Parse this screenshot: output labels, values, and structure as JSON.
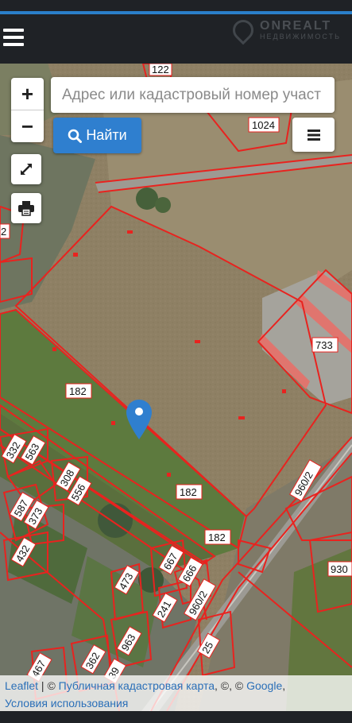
{
  "header": {
    "menu_icon": "hamburger-icon",
    "logo_brand": "ONREALT",
    "logo_sub": "НЕДВИЖИМОСТЬ"
  },
  "controls": {
    "zoom_in": "+",
    "zoom_out": "−",
    "search_placeholder": "Адрес или кадастровый номер участ",
    "find_label": "Найти",
    "layers_icon": "layers-menu-icon",
    "fullscreen_icon": "fullscreen-icon",
    "print_icon": "printer-icon"
  },
  "map": {
    "parcel_labels": [
      "122",
      "1024",
      "2",
      "733",
      "182",
      "182",
      "182",
      "332",
      "563",
      "308",
      "556",
      "587",
      "373",
      "960/2",
      "667",
      "666",
      "432",
      "473",
      "241",
      "960/2",
      "930",
      "963",
      "467",
      "362",
      "39",
      "25"
    ],
    "marker_icon": "location-pin-icon",
    "parcel_color": "#e8231f",
    "accent_color": "#2f7fcf"
  },
  "attribution": {
    "leaflet": "Leaflet",
    "sep1": " | © ",
    "pkk": "Публичная кадастровая карта",
    "sep2": ", ©, © ",
    "google": "Google",
    "sep3": ",",
    "terms": "Условия использования"
  }
}
